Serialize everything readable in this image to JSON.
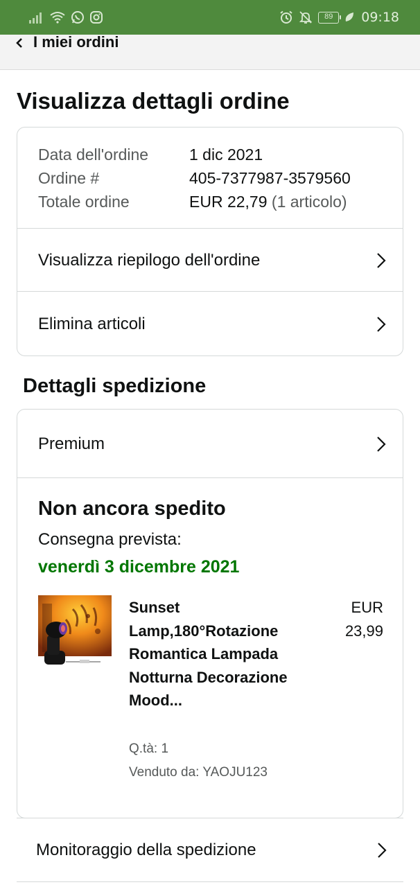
{
  "status_bar": {
    "time": "09:18",
    "battery": "89",
    "left_icons": [
      "signal-icon",
      "wifi-icon",
      "whatsapp-icon",
      "instagram-icon"
    ],
    "right_icons": [
      "alarm-icon",
      "bell-off-icon",
      "battery-icon",
      "leaf-icon"
    ]
  },
  "nav": {
    "back_label": "I miei ordini"
  },
  "page": {
    "title": "Visualizza dettagli ordine"
  },
  "order": {
    "date_label": "Data dell'ordine",
    "date_value": "1 dic 2021",
    "number_label": "Ordine #",
    "number_value": "405-7377987-3579560",
    "total_label": "Totale ordine",
    "total_value": "EUR 22,79",
    "total_items": "(1 articolo)",
    "actions": [
      {
        "label": "Visualizza riepilogo dell'ordine"
      },
      {
        "label": "Elimina articoli"
      }
    ]
  },
  "shipping": {
    "section_title": "Dettagli spedizione",
    "method": "Premium",
    "status": "Non ancora spedito",
    "eta_label": "Consegna prevista:",
    "eta_date": "venerdì 3 dicembre 2021",
    "item": {
      "title": "Sunset Lamp,180°Rotazione Romantica Lampada Notturna Decorazione Mood...",
      "price_currency": "EUR",
      "price_value": "23,99",
      "qty": "Q.tà: 1",
      "seller": "Venduto da: YAOJU123"
    },
    "tracking_label": "Monitoraggio della spedizione"
  },
  "colors": {
    "status_bar": "#4f8a3d",
    "eta_green": "#007600",
    "border": "#d5d9d9",
    "text": "#0f1111",
    "muted": "#565959"
  }
}
